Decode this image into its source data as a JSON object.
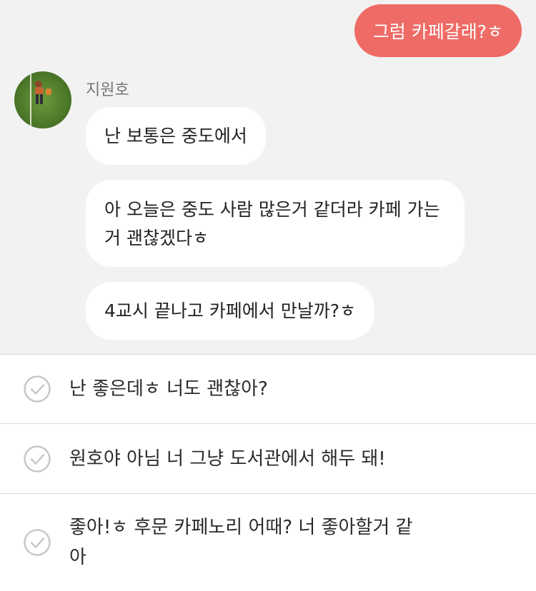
{
  "chat": {
    "outgoing_message": "그럼 카페갈래?ㅎ",
    "sender": {
      "name": "지원호",
      "avatar_icon": "avatar-photo-icon"
    },
    "incoming_messages": [
      {
        "text": "난 보통은 중도에서"
      },
      {
        "text": "아 오늘은 중도 사람 많은거 같더라 카페 가는거 괜찮겠다ㅎ"
      },
      {
        "text": "4교시 끝나고 카페에서 만날까?ㅎ"
      }
    ]
  },
  "reply_options": [
    {
      "text": "난 좋은데ㅎ 너도 괜찮아?",
      "icon": "check-circle-icon"
    },
    {
      "text": "원호야 아님 너 그냥 도서관에서 해두 돼!",
      "icon": "check-circle-icon"
    },
    {
      "text": "좋아!ㅎ 후문 카페노리 어때? 너 좋아할거 같아",
      "icon": "check-circle-icon"
    }
  ],
  "colors": {
    "outgoing_bubble": "#ee6b66",
    "chat_background": "#f2f2f2",
    "incoming_bubble": "#ffffff",
    "check_icon": "#c8c8c8"
  }
}
